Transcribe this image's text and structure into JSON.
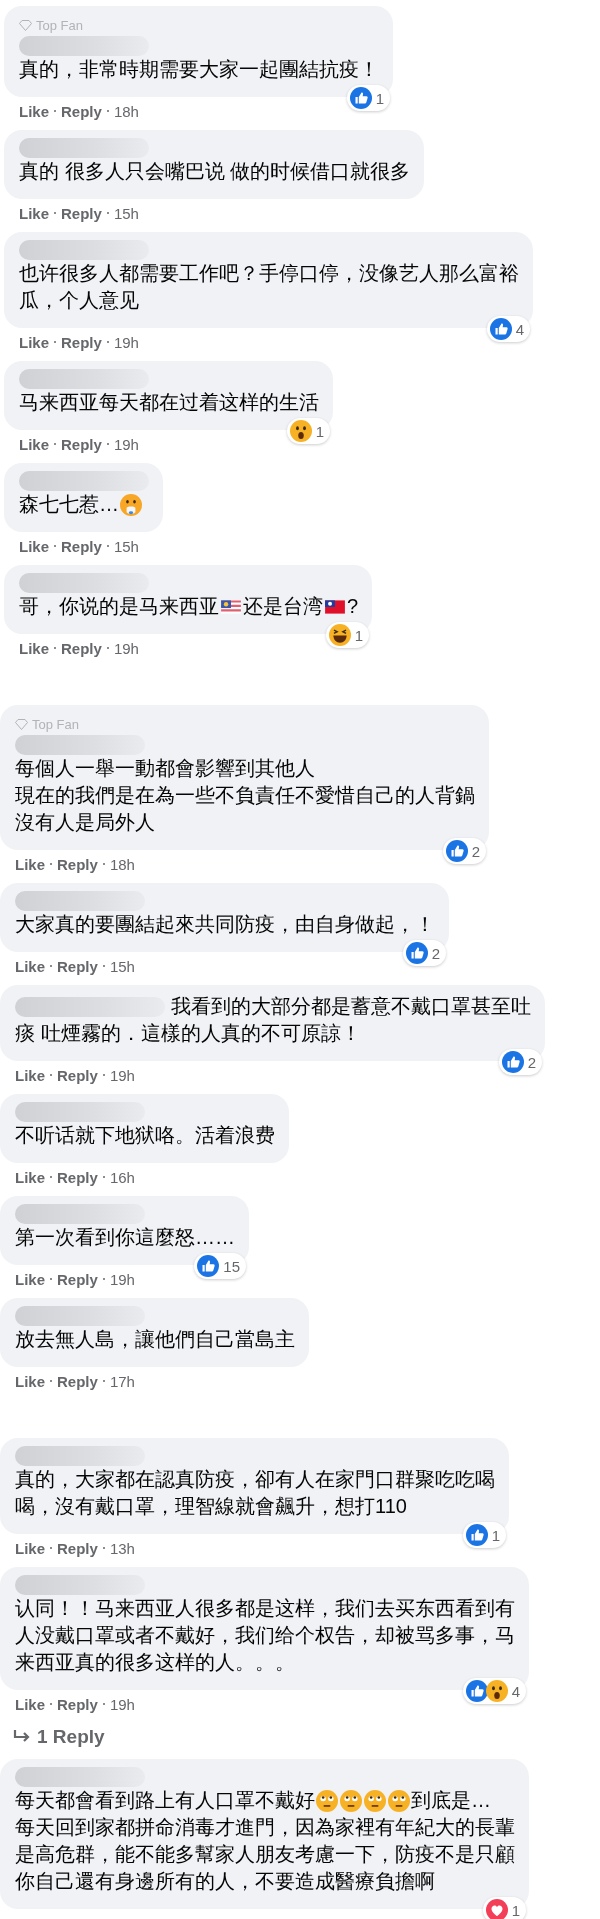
{
  "threads": [
    {
      "comments": [
        {
          "badge": "Top Fan",
          "lines": [
            [
              {
                "kind": "text",
                "text": "真的，非常時期需要大家一起團結抗疫！"
              }
            ]
          ],
          "reactions": [
            {
              "kind": "like"
            }
          ],
          "count": "1",
          "actions": [
            "Like",
            "Reply"
          ],
          "time": "18h"
        },
        {
          "lines": [
            [
              {
                "kind": "text",
                "text": "真的 很多人只会嘴巴说 做的时候借口就很多"
              }
            ]
          ],
          "actions": [
            "Like",
            "Reply"
          ],
          "time": "15h"
        },
        {
          "lines": [
            [
              {
                "kind": "text",
                "text": "也许很多人都需要工作吧？手停口停，没像艺人那么富裕"
              }
            ],
            [
              {
                "kind": "text",
                "text": "瓜，个人意见"
              }
            ]
          ],
          "reactions": [
            {
              "kind": "like"
            }
          ],
          "count": "4",
          "actions": [
            "Like",
            "Reply"
          ],
          "time": "19h"
        },
        {
          "lines": [
            [
              {
                "kind": "text",
                "text": "马来西亚每天都在过着这样的生活"
              }
            ]
          ],
          "reactions": [
            {
              "kind": "wow"
            }
          ],
          "count": "1",
          "actions": [
            "Like",
            "Reply"
          ],
          "time": "19h"
        },
        {
          "lines": [
            [
              {
                "kind": "text",
                "text": "森七七惹…"
              },
              {
                "kind": "hushed"
              }
            ]
          ],
          "actions": [
            "Like",
            "Reply"
          ],
          "time": "15h"
        },
        {
          "lines": [
            [
              {
                "kind": "text",
                "text": "哥，你说的是马来西亚"
              },
              {
                "kind": "stripes"
              },
              {
                "kind": "text",
                "text": "还是台湾"
              },
              {
                "kind": "flag"
              },
              {
                "kind": "text",
                "text": "?"
              }
            ]
          ],
          "reactions": [
            {
              "kind": "haha"
            }
          ],
          "count": "1",
          "actions": [
            "Like",
            "Reply"
          ],
          "time": "19h"
        }
      ]
    },
    {
      "comments": [
        {
          "badge": "Top Fan",
          "lines": [
            [
              {
                "kind": "text",
                "text": "每個人一舉一動都會影響到其他人"
              }
            ],
            [
              {
                "kind": "text",
                "text": "現在的我們是在為一些不負責任不愛惜自己的人背鍋"
              }
            ],
            [
              {
                "kind": "text",
                "text": "沒有人是局外人"
              }
            ]
          ],
          "reactions": [
            {
              "kind": "like"
            }
          ],
          "count": "2",
          "actions": [
            "Like",
            "Reply"
          ],
          "time": "18h"
        },
        {
          "lines": [
            [
              {
                "kind": "text",
                "text": "大家真的要團結起來共同防疫，由自身做起，！"
              }
            ]
          ],
          "reactions": [
            {
              "kind": "like"
            }
          ],
          "count": "2",
          "actions": [
            "Like",
            "Reply"
          ],
          "time": "15h"
        },
        {
          "name_inline": true,
          "lines": [
            [
              {
                "kind": "text",
                "text": "我看到的大部分都是蓄意不戴口罩甚至吐"
              }
            ],
            [
              {
                "kind": "text",
                "text": "痰 吐煙霧的．這樣的人真的不可原諒！"
              }
            ]
          ],
          "reactions": [
            {
              "kind": "like"
            }
          ],
          "count": "2",
          "actions": [
            "Like",
            "Reply"
          ],
          "time": "19h"
        },
        {
          "lines": [
            [
              {
                "kind": "text",
                "text": "不听话就下地狱咯。活着浪费"
              }
            ]
          ],
          "actions": [
            "Like",
            "Reply"
          ],
          "time": "16h"
        },
        {
          "lines": [
            [
              {
                "kind": "text",
                "text": "第一次看到你這麼怒……"
              }
            ]
          ],
          "reactions": [
            {
              "kind": "like"
            }
          ],
          "count": "15",
          "actions": [
            "Like",
            "Reply"
          ],
          "time": "19h"
        },
        {
          "lines": [
            [
              {
                "kind": "text",
                "text": "放去無人島，讓他們自己當島主"
              }
            ]
          ],
          "actions": [
            "Like",
            "Reply"
          ],
          "time": "17h"
        }
      ]
    },
    {
      "comments": [
        {
          "lines": [
            [
              {
                "kind": "text",
                "text": "真的，大家都在認真防疫，卻有人在家門口群聚吃吃喝"
              }
            ],
            [
              {
                "kind": "text",
                "text": "喝，沒有戴口罩，理智線就會飆升，想打110"
              }
            ]
          ],
          "reactions": [
            {
              "kind": "like"
            }
          ],
          "count": "1",
          "actions": [
            "Like",
            "Reply"
          ],
          "time": "13h"
        },
        {
          "lines": [
            [
              {
                "kind": "text",
                "text": "认同！！马来西亚人很多都是这样，我们去买东西看到有"
              }
            ],
            [
              {
                "kind": "text",
                "text": "人没戴口罩或者不戴好，我们给个权告，却被骂多事，马"
              }
            ],
            [
              {
                "kind": "text",
                "text": "来西亚真的很多这样的人。。。"
              }
            ]
          ],
          "reactions": [
            {
              "kind": "like"
            },
            {
              "kind": "wow"
            }
          ],
          "count": "4",
          "actions": [
            "Like",
            "Reply"
          ],
          "time": "19h",
          "replies": "1 Reply"
        },
        {
          "lines": [
            [
              {
                "kind": "text",
                "text": "每天都會看到路上有人口罩不戴好"
              },
              {
                "kind": "eyeroll"
              },
              {
                "kind": "eyeroll"
              },
              {
                "kind": "eyeroll"
              },
              {
                "kind": "eyeroll"
              },
              {
                "kind": "text",
                "text": "到底是…"
              }
            ],
            [
              {
                "kind": "text",
                "text": "每天回到家都拼命消毒才進門，因為家裡有年紀大的長輩"
              }
            ],
            [
              {
                "kind": "text",
                "text": "是高危群，能不能多幫家人朋友考慮一下，防疫不是只顧"
              }
            ],
            [
              {
                "kind": "text",
                "text": "你自己還有身邊所有的人，不要造成醫療負擔啊"
              }
            ]
          ],
          "reactions": [
            {
              "kind": "heart"
            }
          ],
          "count": "1"
        }
      ]
    }
  ]
}
